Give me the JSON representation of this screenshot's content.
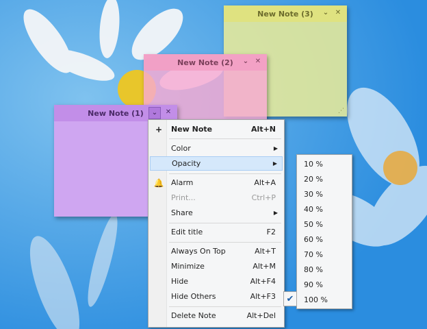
{
  "notes": [
    {
      "id": "note3",
      "title": "New Note (3)",
      "color": "#ecec96"
    },
    {
      "id": "note2",
      "title": "New Note (2)",
      "color": "#f7aad2"
    },
    {
      "id": "note1",
      "title": "New Note (1)",
      "color": "#cfa6f1"
    }
  ],
  "menu": {
    "new_note": {
      "label": "New Note",
      "shortcut": "Alt+N"
    },
    "color": {
      "label": "Color"
    },
    "opacity": {
      "label": "Opacity"
    },
    "alarm": {
      "label": "Alarm",
      "shortcut": "Alt+A"
    },
    "print": {
      "label": "Print...",
      "shortcut": "Ctrl+P"
    },
    "share": {
      "label": "Share"
    },
    "edit_title": {
      "label": "Edit title",
      "shortcut": "F2"
    },
    "always_on_top": {
      "label": "Always On Top",
      "shortcut": "Alt+T"
    },
    "minimize": {
      "label": "Minimize",
      "shortcut": "Alt+M"
    },
    "hide": {
      "label": "Hide",
      "shortcut": "Alt+F4"
    },
    "hide_others": {
      "label": "Hide Others",
      "shortcut": "Alt+F3"
    },
    "delete_note": {
      "label": "Delete Note",
      "shortcut": "Alt+Del"
    }
  },
  "opacity_menu": {
    "items": [
      "10 %",
      "20 %",
      "30 %",
      "40 %",
      "50 %",
      "60 %",
      "70 %",
      "80 %",
      "90 %",
      "100 %"
    ],
    "selected": "100 %"
  },
  "colors": {
    "desktop": "#3b98de",
    "highlight": "#d5e8fb",
    "check": "#1d5fa8"
  }
}
